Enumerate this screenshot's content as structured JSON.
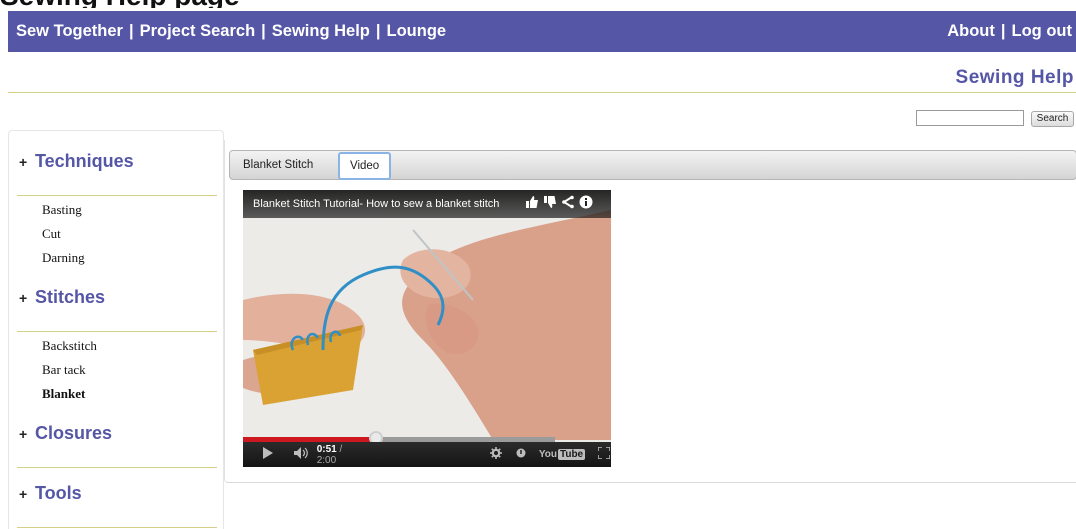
{
  "page": {
    "heading": "Sewing Help page"
  },
  "topbar": {
    "nav": [
      "Sew Together",
      "Project Search",
      "Sewing Help",
      "Lounge"
    ],
    "separator": "|",
    "user_links": [
      "About",
      "Log out"
    ],
    "background": "#5556a5"
  },
  "section_title": "Sewing Help",
  "search": {
    "value": "",
    "button_label": "Search"
  },
  "sidebar": {
    "plus": "+",
    "categories": [
      {
        "label": "Techniques",
        "items": [
          {
            "label": "Basting"
          },
          {
            "label": "Cut"
          },
          {
            "label": "Darning"
          }
        ]
      },
      {
        "label": "Stitches",
        "items": [
          {
            "label": "Backstitch"
          },
          {
            "label": "Bar tack"
          },
          {
            "label": "Blanket",
            "selected": true
          }
        ]
      },
      {
        "label": "Closures",
        "items": []
      },
      {
        "label": "Tools",
        "items": []
      }
    ]
  },
  "tabs": [
    {
      "label": "Blanket Stitch",
      "active": false
    },
    {
      "label": "Video",
      "active": true
    }
  ],
  "video": {
    "title": "Blanket Stitch Tutorial- How to sew a blanket stitch",
    "icons": [
      "thumbs-up-icon",
      "thumbs-down-icon",
      "share-icon",
      "info-icon"
    ],
    "progress_fraction": 0.425,
    "time_current": "0:51",
    "time_separator": " / ",
    "time_total": "2:00",
    "logo_text": "You",
    "logo_box": "Tube"
  },
  "colors": {
    "accent": "#5556a5",
    "rule": "#d4d08a",
    "progress": "#cc181e",
    "thread": "#2f8fc6",
    "felt": "#d9a233"
  }
}
